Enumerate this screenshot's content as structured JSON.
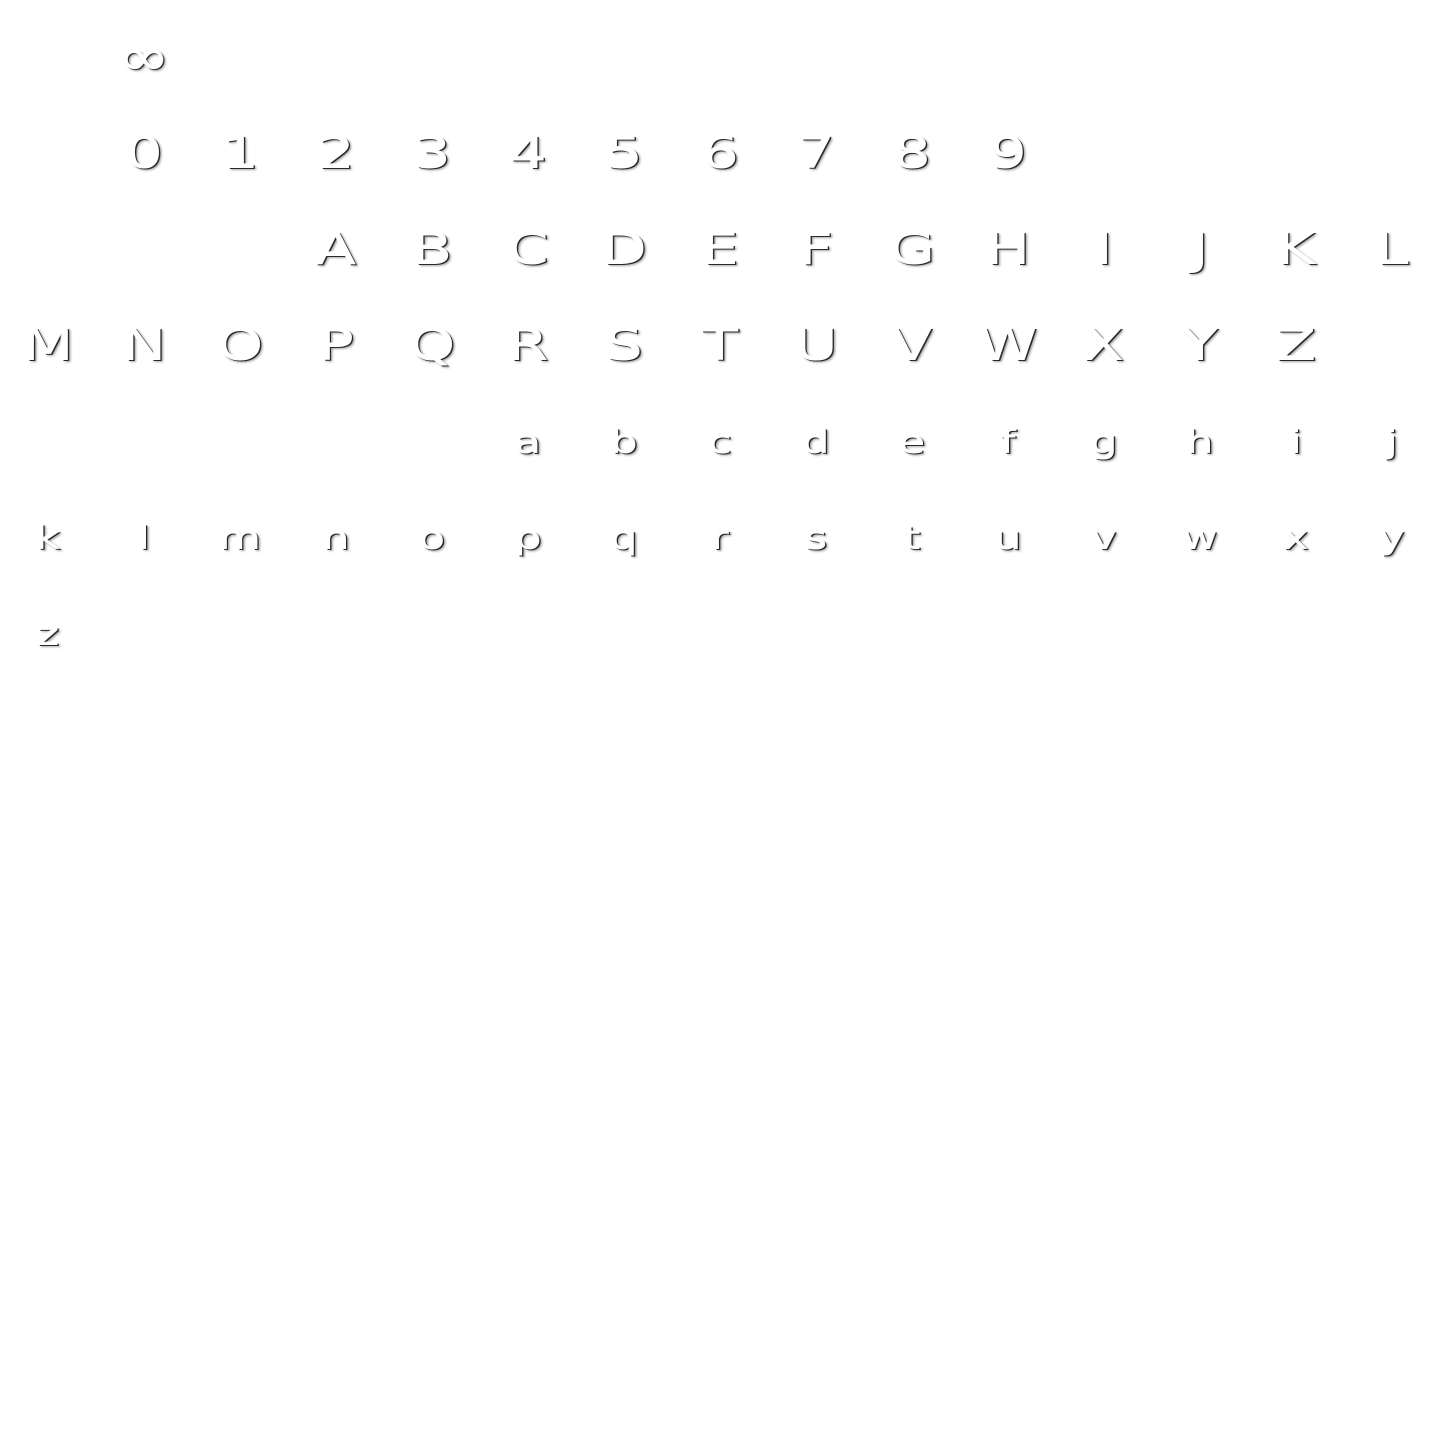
{
  "background_color": "#ffffff",
  "glyph_color": "#ffffff",
  "shadow_color": "#2a2a2a",
  "glyphs": [
    {
      "char": "∞",
      "kind": "symbol"
    },
    {
      "char": "0",
      "kind": "digit"
    },
    {
      "char": "1",
      "kind": "digit"
    },
    {
      "char": "2",
      "kind": "digit"
    },
    {
      "char": "3",
      "kind": "digit"
    },
    {
      "char": "4",
      "kind": "digit"
    },
    {
      "char": "5",
      "kind": "digit"
    },
    {
      "char": "6",
      "kind": "digit"
    },
    {
      "char": "7",
      "kind": "digit"
    },
    {
      "char": "8",
      "kind": "digit"
    },
    {
      "char": "9",
      "kind": "digit"
    },
    {
      "char": "A",
      "kind": "upper"
    },
    {
      "char": "B",
      "kind": "upper"
    },
    {
      "char": "C",
      "kind": "upper"
    },
    {
      "char": "D",
      "kind": "upper"
    },
    {
      "char": "E",
      "kind": "upper"
    },
    {
      "char": "F",
      "kind": "upper"
    },
    {
      "char": "G",
      "kind": "upper"
    },
    {
      "char": "H",
      "kind": "upper"
    },
    {
      "char": "I",
      "kind": "upper"
    },
    {
      "char": "J",
      "kind": "upper"
    },
    {
      "char": "K",
      "kind": "upper"
    },
    {
      "char": "L",
      "kind": "upper"
    },
    {
      "char": "M",
      "kind": "upper"
    },
    {
      "char": "N",
      "kind": "upper"
    },
    {
      "char": "O",
      "kind": "upper"
    },
    {
      "char": "P",
      "kind": "upper"
    },
    {
      "char": "Q",
      "kind": "upper"
    },
    {
      "char": "R",
      "kind": "upper"
    },
    {
      "char": "S",
      "kind": "upper"
    },
    {
      "char": "T",
      "kind": "upper"
    },
    {
      "char": "U",
      "kind": "upper"
    },
    {
      "char": "V",
      "kind": "upper"
    },
    {
      "char": "W",
      "kind": "upper"
    },
    {
      "char": "X",
      "kind": "upper"
    },
    {
      "char": "Y",
      "kind": "upper"
    },
    {
      "char": "Z",
      "kind": "upper"
    },
    {
      "char": "a",
      "kind": "lower"
    },
    {
      "char": "b",
      "kind": "lower"
    },
    {
      "char": "c",
      "kind": "lower"
    },
    {
      "char": "d",
      "kind": "lower"
    },
    {
      "char": "e",
      "kind": "lower"
    },
    {
      "char": "f",
      "kind": "lower"
    },
    {
      "char": "g",
      "kind": "lower"
    },
    {
      "char": "h",
      "kind": "lower"
    },
    {
      "char": "i",
      "kind": "lower"
    },
    {
      "char": "j",
      "kind": "lower"
    },
    {
      "char": "k",
      "kind": "lower"
    },
    {
      "char": "l",
      "kind": "lower"
    },
    {
      "char": "m",
      "kind": "lower"
    },
    {
      "char": "n",
      "kind": "lower"
    },
    {
      "char": "o",
      "kind": "lower"
    },
    {
      "char": "p",
      "kind": "lower"
    },
    {
      "char": "q",
      "kind": "lower"
    },
    {
      "char": "r",
      "kind": "lower"
    },
    {
      "char": "s",
      "kind": "lower"
    },
    {
      "char": "t",
      "kind": "lower"
    },
    {
      "char": "u",
      "kind": "lower"
    },
    {
      "char": "v",
      "kind": "lower"
    },
    {
      "char": "w",
      "kind": "lower"
    },
    {
      "char": "x",
      "kind": "lower"
    },
    {
      "char": "y",
      "kind": "lower"
    },
    {
      "char": "z",
      "kind": "lower"
    }
  ]
}
